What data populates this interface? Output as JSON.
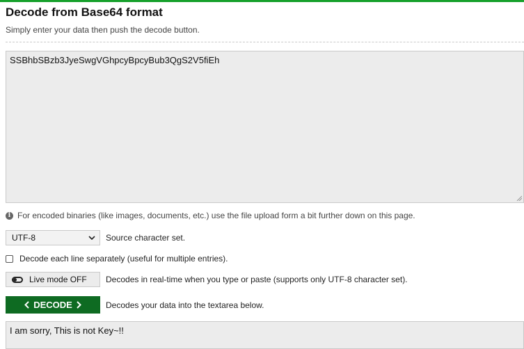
{
  "header": {
    "title": "Decode from Base64 format",
    "subtitle": "Simply enter your data then push the decode button."
  },
  "input": {
    "value": "SSBhbSBzb3JyeSwgVGhpcyBpcyBub3QgS2V5fiEh"
  },
  "info": {
    "text": "For encoded binaries (like images, documents, etc.) use the file upload form a bit further down on this page."
  },
  "charset": {
    "selected": "UTF-8",
    "label": "Source character set."
  },
  "decode_each_line": {
    "label": "Decode each line separately (useful for multiple entries).",
    "checked": false
  },
  "live_mode": {
    "button_label": "Live mode OFF",
    "description": "Decodes in real-time when you type or paste (supports only UTF-8 character set)."
  },
  "decode": {
    "button_label": "DECODE",
    "description": "Decodes your data into the textarea below."
  },
  "output": {
    "value": "I am sorry, This is not Key~!!"
  },
  "colors": {
    "accent_green": "#0e6b22",
    "top_bar_green": "#16a02b",
    "textarea_bg": "#ececec"
  }
}
